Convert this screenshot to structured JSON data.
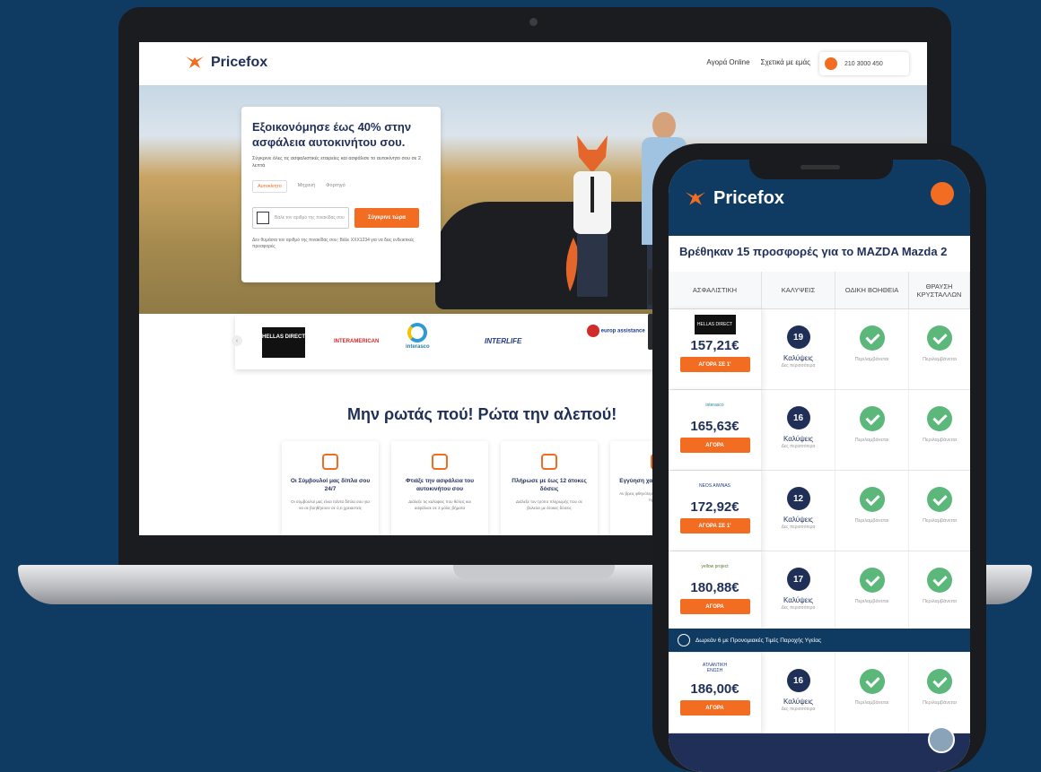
{
  "laptop": {
    "logo": "Pricefox",
    "nav": [
      "Αγορά Online",
      "Σχετικά με εμάς"
    ],
    "phone_number": "210 3000 450",
    "hero": {
      "title": "Εξοικονόμησε έως 40% στην ασφάλεια αυτοκινήτου σου.",
      "subtitle": "Σύγκρινε όλες τις ασφαλιστικές εταιρείες και ασφάλισε το αυτοκίνητο σου σε 2 λεπτά",
      "tabs": [
        "Αυτοκίνητο",
        "Μηχανή",
        "Φορτηγό"
      ],
      "plate_placeholder": "Βάλε τον αριθμό της πινακίδας σου",
      "cta": "Σύγκρινε τώρα",
      "note": "Δεν θυμάσαι τον αριθμό της πινακίδας σου; Βάλε ΧΧΧ1234 για να δεις ενδεικτικές προσφορές"
    },
    "partners": [
      "HELLAS DIRECT",
      "INTERAMERICAN",
      "interasco",
      "INTERLIFE",
      "europ assistance"
    ],
    "slogan": "Μην ρωτάς πού! Ρώτα την αλεπού!",
    "features": [
      {
        "title": "Οι Σύμβουλοί μας δίπλα σου 24/7",
        "text": "Οι σύμβουλοί μας είναι πάντα δίπλα σου για να σε βοηθήσουν σε ό,τι χρειαστείς"
      },
      {
        "title": "Φτιάξε την ασφάλεια του αυτοκινήτου σου",
        "text": "Διάλεξε τις καλύψεις που θέλεις και ασφάλισε σε 2 μόλις βήματα"
      },
      {
        "title": "Πλήρωσε με έως 12 άτοκες δόσεις",
        "text": "Διάλεξε τον τρόπο πληρωμής που σε βολεύει με άτοκες δόσεις"
      },
      {
        "title": "Εγγύηση χαμηλότερης τιμής",
        "text": "Αν βρεις φθηνότερη τιμή, σου επιστρέφουμε τη διαφορά"
      }
    ]
  },
  "phone": {
    "logo": "Pricefox",
    "title": "Βρέθηκαν 15 προσφορές για το MAZDA Mazda 2",
    "columns": [
      "ΑΣΦΑΛΙΣΤΙΚΗ",
      "ΚΑΛΥΨΕΙΣ",
      "ΟΔΙΚΗ ΒΟΗΘΕΙΑ",
      "ΘΡΑΥΣΗ ΚΡΥΣΤΑΛΛΩΝ"
    ],
    "coverage_label": "Καλύψεις",
    "coverage_sub": "Δες περισσότερα",
    "included": "Περιλαμβάνεται",
    "offers": [
      {
        "insurer": "HELLAS DIRECT",
        "price": "157,21€",
        "button": "ΑΓΟΡΑ ΣΕ 1'",
        "coverages": "19"
      },
      {
        "insurer": "interasco",
        "price": "165,63€",
        "button": "ΑΓΟΡΑ",
        "coverages": "16"
      },
      {
        "insurer": "NEOS AIWNAS",
        "price": "172,92€",
        "button": "ΑΓΟΡΑ ΣΕ 1'",
        "coverages": "12"
      },
      {
        "insurer": "yellow project",
        "price": "180,88€",
        "button": "ΑΓΟΡΑ",
        "coverages": "17"
      },
      {
        "insurer": "ΑΤΛΑΝΤΙΚΗ ΕΝΩΣΗ",
        "price": "186,00€",
        "button": "ΑΓΟΡΑ",
        "coverages": "16"
      }
    ],
    "banner": "Δωρεάν 6 με Προνομιακές Τιμές Παροχής Υγείας"
  },
  "colors": {
    "background": "#0f3b63",
    "accent": "#f26c21",
    "navy": "#1f2f57",
    "check": "#5cb87a"
  }
}
